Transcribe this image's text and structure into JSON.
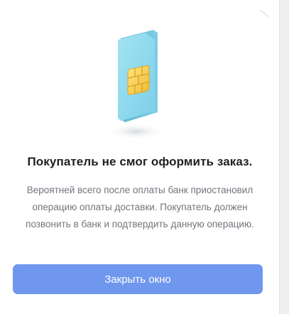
{
  "dialog": {
    "title": "Покупатель не смог оформить заказ.",
    "description": "Вероятней всего после оплаты банк приостановил операцию оплаты доставки. Покупатель должен позвонить в банк и подтвердить данную операцию.",
    "close_button_label": "Закрыть окно",
    "illustration_icon": "sim-card-icon",
    "close_icon": "close-icon"
  },
  "colors": {
    "accent": "#6f97ee",
    "sim_card": "#8fd8ee",
    "chip": "#f2c94c",
    "title_text": "#1f2024",
    "body_text": "#70757c"
  }
}
